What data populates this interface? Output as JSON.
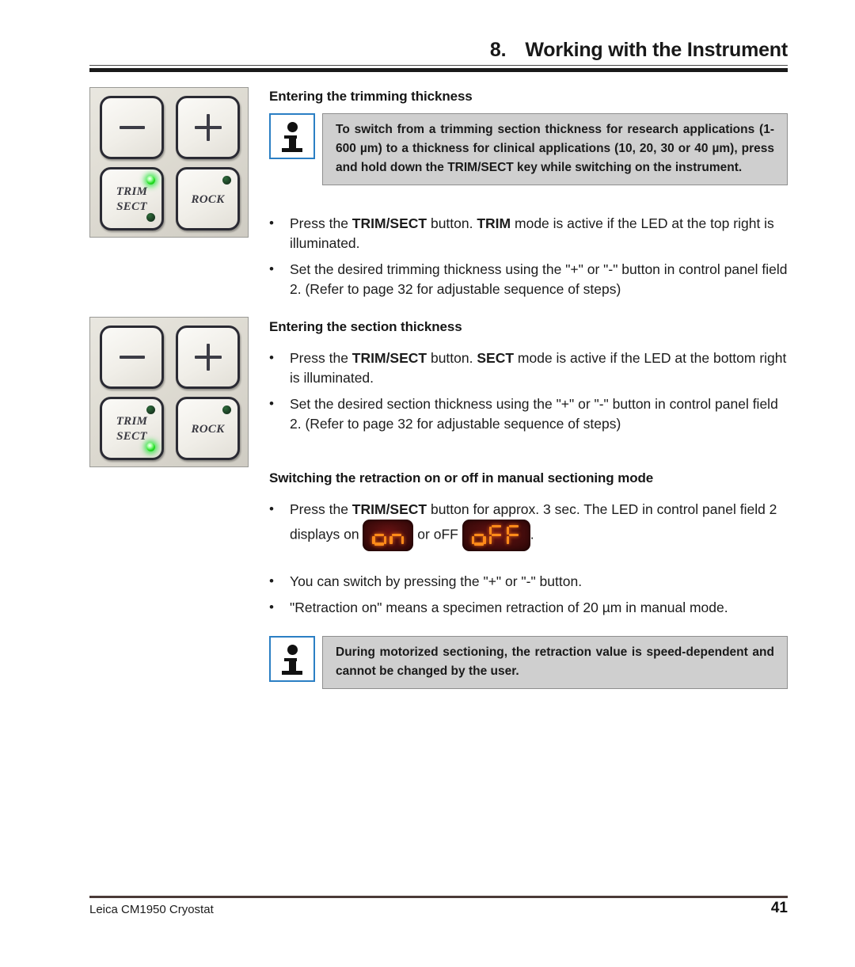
{
  "header": {
    "number": "8.",
    "title": "Working with the Instrument"
  },
  "sections": [
    {
      "heading": "Entering the trimming thickness",
      "note": "To switch from a trimming section thickness for research applications (1-600 µm) to a thickness for clinical applications (10, 20, 30 or 40 µm), press and hold down the TRIM/SECT key while switching on the instrument.",
      "bullets": [
        {
          "pre": "Press the ",
          "b1": "TRIM/SECT",
          "mid": " button. ",
          "b2": "TRIM",
          "post": " mode is active if the LED at the top right is illuminated."
        },
        {
          "text": "Set the desired trimming thickness using the \"+\" or \"-\" button in control panel field 2. (Refer to page 32 for adjustable sequence of steps)"
        }
      ]
    },
    {
      "heading": "Entering the section thickness",
      "bullets": [
        {
          "pre": "Press the ",
          "b1": "TRIM/SECT",
          "mid": " button. ",
          "b2": "SECT",
          "post": " mode is active if the LED at the bottom right is illuminated."
        },
        {
          "text": "Set the desired section thickness using the \"+\" or \"-\" button in control panel field 2. (Refer to page 32 for adjustable sequence of steps)"
        }
      ]
    },
    {
      "heading": "Switching the retraction on or off in manual sectioning mode",
      "bullets": [
        {
          "pre": "Press the ",
          "b1": "TRIM/SECT",
          "post": " button for approx. 3 sec. The LED in control panel field 2 displays on ",
          "mid2": " or oFF ",
          "tail": "."
        },
        {
          "text": "You can switch by pressing the \"+\" or \"-\" button."
        },
        {
          "text": "\"Retraction on\" means a specimen retraction of 20 µm in manual mode."
        }
      ],
      "note": "During motorized sectioning, the retraction value is speed-dependent and cannot be changed by the user."
    }
  ],
  "led_displays": {
    "on": {
      "text": "on",
      "digits": [
        "o",
        "n"
      ]
    },
    "off": {
      "text": "oFF",
      "digits": [
        "o",
        "F",
        "F"
      ]
    },
    "background_color": "#4a0d0d",
    "segment_color": "#ff8c1a"
  },
  "keypads": [
    {
      "caption_mode": "TRIM",
      "keys": [
        {
          "label": "",
          "glyph": "minus"
        },
        {
          "label": "",
          "glyph": "plus"
        },
        {
          "label_line1": "TRIM",
          "label_line2": "SECT"
        },
        {
          "label_line1": "ROCK",
          "label_line2": ""
        }
      ],
      "leds": {
        "trim_sect_top_right": "on",
        "trim_sect_bottom_left": "off",
        "rock_top_right": "off"
      }
    },
    {
      "caption_mode": "SECT",
      "keys": [
        {
          "label": "",
          "glyph": "minus"
        },
        {
          "label": "",
          "glyph": "plus"
        },
        {
          "label_line1": "TRIM",
          "label_line2": "SECT"
        },
        {
          "label_line1": "ROCK",
          "label_line2": ""
        }
      ],
      "leds": {
        "trim_sect_top_right": "off",
        "trim_sect_bottom_left": "on",
        "rock_top_right": "off"
      }
    }
  ],
  "footer": {
    "left": "Leica CM1950 Cryostat",
    "page_number": "41"
  },
  "colors": {
    "note_border": "#2b7fc4",
    "note_background": "#cfcfcf",
    "led_green": "#22dd22",
    "rule": "#1a1a1a"
  }
}
